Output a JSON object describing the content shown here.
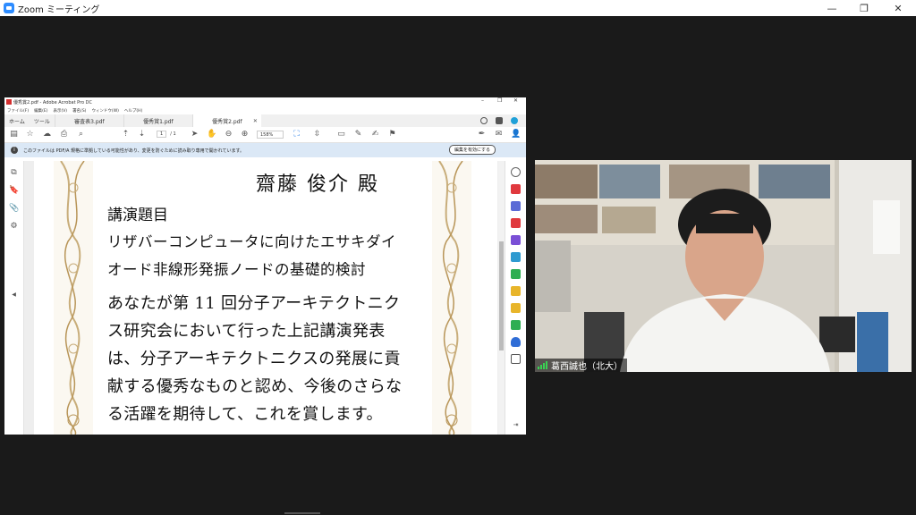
{
  "window": {
    "title": "Zoom ミーティング",
    "minimize": "—",
    "restore": "❐",
    "close": "✕"
  },
  "acrobat": {
    "title": "優秀賞2.pdf - Adobe Acrobat Pro DC",
    "menu": [
      "ファイル(F)",
      "編集(E)",
      "表示(V)",
      "署名(S)",
      "ウィンドウ(W)",
      "ヘルプ(H)"
    ],
    "nav_tabs": [
      "ホーム",
      "ツール"
    ],
    "doc_tabs": [
      {
        "label": "審査表3.pdf",
        "active": false
      },
      {
        "label": "優秀賞1.pdf",
        "active": false
      },
      {
        "label": "優秀賞2.pdf",
        "active": true
      }
    ],
    "page_current": "1",
    "page_total": "/ 1",
    "zoom": "158%",
    "info_message": "このファイルは PDF/A 規格に準拠している可能性があり、変更を防ぐために読み取り専用で開かれています。",
    "info_button": "編集を有効にする"
  },
  "certificate": {
    "recipient": "齋藤 俊介 殿",
    "heading": "講演題目",
    "title_lines": [
      "リザバーコンピュータに向けたエサキダイ",
      "オード非線形発振ノードの基礎的検討"
    ],
    "body_lines": [
      "あなたが第 11 回分子アーキテクトニク",
      "ス研究会において行った上記講演発表",
      "は、分子アーキテクトニクスの発展に貢",
      "献する優秀なものと認め、今後のさらな",
      "る活躍を期待して、これを賞します。"
    ]
  },
  "video": {
    "participant_name": "葛西誠也（北大）"
  },
  "colors": {
    "zoom_blue": "#2d8cff",
    "info_bar": "#dbe8f6",
    "border_gold": "#c8ad7a"
  }
}
